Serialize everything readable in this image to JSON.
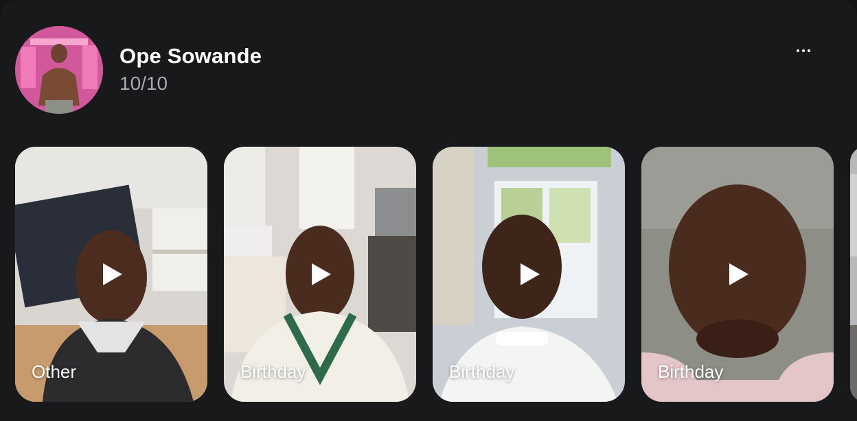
{
  "profile": {
    "name": "Ope Sowande",
    "count": "10/10",
    "avatar_icon": "person-photo",
    "more_icon": "more-horizontal-icon"
  },
  "videos": [
    {
      "label": "Other",
      "icon": "play-icon"
    },
    {
      "label": "Birthday",
      "icon": "play-icon"
    },
    {
      "label": "Birthday",
      "icon": "play-icon"
    },
    {
      "label": "Birthday",
      "icon": "play-icon"
    }
  ],
  "colors": {
    "background": "#18191b",
    "secondary_text": "#a7a9ad",
    "avatar_accent": "#e86aa6"
  }
}
